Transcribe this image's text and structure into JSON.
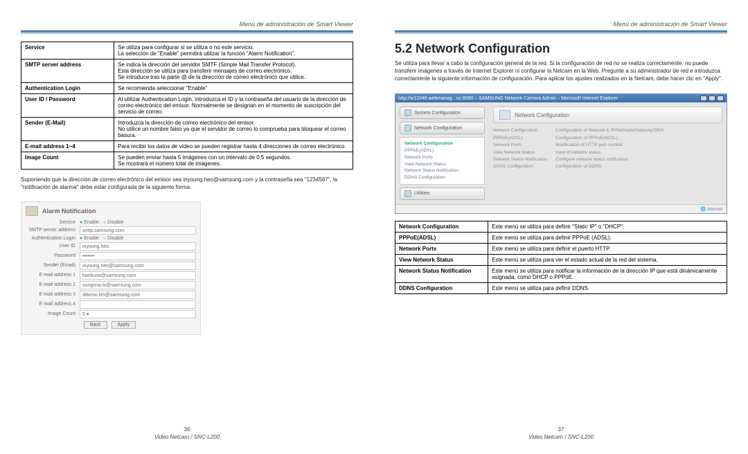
{
  "leftPage": {
    "header": "Menú de administración de Smart Viewer",
    "table": [
      {
        "k": "Service",
        "v": "Se utiliza para configurar si se utiliza o no este servicio.\nLa selección de \"Enable\" permitirá utilizar la función \"Alarm Notification\"."
      },
      {
        "k": "SMTP server address",
        "v": "Se indica la dirección del servidor SMTF (Simple Mail Transfer Protocol).\nEsta dirección se utiliza para transferir mensajes de correo electrónico.\nSe introduce tras la parte @ de la dirección de correo electrónico que utilice."
      },
      {
        "k": "Authentication Login",
        "v": "Se recomienda seleccionar \"Enable\""
      },
      {
        "k": "User ID / Password",
        "v": "Al utilizar Authentication Login, introduzca el ID y la contraseña del usuario de la dirección de correo electrónico del emisor. Normalmente se designan en el momento de suscripción del servicio de correo."
      },
      {
        "k": "Sender (E-Mail)",
        "v": "Introduzca la dirección de correo electrónico del emisor.\nNo utilice un nombre falso ya que el servidor de correo lo comprueba para bloquear el correo basura."
      },
      {
        "k": "E-mail address 1~4",
        "v": "Para recibir los datos de vídeo se pueden registrar hasta 4 direcciones de correo electrónico."
      },
      {
        "k": "Image Count",
        "v": "Se pueden enviar hasta 5 imágenes con un intervalo de 0,5 segundos.\nSe mostrará el número total de imágenes."
      }
    ],
    "note": "Suponiendo que la dirección de correo electrónico del emisor sea inyoung.heo@samsung.com y la contraseña sea \"1234567\", la \"notificación de alarma\" debe estar configurada de la siguiente forma.",
    "form": {
      "title": "Alarm Notification",
      "rows": [
        {
          "label": "Service",
          "value": "",
          "type": "radio",
          "opts": [
            "Enable",
            "Disable"
          ],
          "sel": 0
        },
        {
          "label": "SMTP server address",
          "value": "smtp.samsung.com"
        },
        {
          "label": "Authentication Login",
          "value": "",
          "type": "radio",
          "opts": [
            "Enable",
            "Disable"
          ],
          "sel": 0
        },
        {
          "label": "User ID",
          "value": "inyoung.heo"
        },
        {
          "label": "Password",
          "value": "•••••••"
        },
        {
          "label": "Sender (Email)",
          "value": "inyoung.heo@samsung.com"
        },
        {
          "label": "E-mail address 1",
          "value": "hankusa@samsung.com"
        },
        {
          "label": "E-mail address 2",
          "value": "sungoria.lo@samsung.com"
        },
        {
          "label": "E-mail address 3",
          "value": "dduroo.lim@samsung.com"
        },
        {
          "label": "E-mail address 4",
          "value": ""
        },
        {
          "label": "Image Count",
          "value": "5 ▾"
        }
      ],
      "buttons": [
        "Back",
        "Apply"
      ]
    },
    "pageNumber": "36",
    "product": "Video Netcam / SNC-L200"
  },
  "rightPage": {
    "header": "Menú de administración de Smart Viewer",
    "title": "5.2 Network Configuration",
    "intro": "Se utiliza para llevar a cabo la configuración general de la red. Si la configuración de red no se realiza correctamente, no puede transferir imágenes a través de Internet Explorer ni configurar la Netcam en la Web. Pregunte a su administrador de red e introduzca correctamente la siguiente información de configuración. Para aplicar los ajustes realizados en la Netcam, debe hacer clic en \"Apply\".",
    "window": {
      "title": "http://w11046.webmanag...nc:8080 – SAMSUNG Network Camera Admin – Microsoft Internet Explorer",
      "sidebarButtons": [
        "System Configuration",
        "Network Configuration"
      ],
      "navItems": [
        "Network Configuration",
        "PPPoE(ADSL)",
        "Network Ports",
        "View Network Status",
        "Network Status Notification",
        "DDNS Configuration"
      ],
      "utilities": "Utilities",
      "paneTitle": "Network Configuration",
      "paneRows": [
        {
          "k": "Network Configuration",
          "v": "Configuration of Network & IP/Netmask/Gateway/DNS."
        },
        {
          "k": "PPPoE(ADSL)",
          "v": "Configuration of PPPoE(ADSL)."
        },
        {
          "k": "Network Ports",
          "v": "Modification of HTTP port number."
        },
        {
          "k": "View Network Status",
          "v": "View of network status."
        },
        {
          "k": "Network Status Notification",
          "v": "Configure network status notification."
        },
        {
          "k": "DDNS Configuration",
          "v": "Configuration of DDNS."
        }
      ],
      "status": "Internet"
    },
    "table": [
      {
        "k": "Network Configuration",
        "v": "Este menú se utiliza para definir \"Static IP\" o \"DHCP\"."
      },
      {
        "k": "PPPoE(ADSL)",
        "v": "Este menú se utiliza para definir PPPoE (ADSL)."
      },
      {
        "k": "Network Ports",
        "v": "Este menú se utiliza para definir el puerto HTTP."
      },
      {
        "k": "View Network Status",
        "v": "Este menú se utiliza para ver el estado actual de la red del sistema."
      },
      {
        "k": "Network Status Notification",
        "v": "Este menú se utiliza para notificar la información de la dirección IP que está dinámicamente asignada, como DHCP o PPPoE."
      },
      {
        "k": "DDNS Configuration",
        "v": "Este menú se utiliza para definir DDNS."
      }
    ],
    "pageNumber": "37",
    "product": "Video Netcam / SNC-L200"
  }
}
